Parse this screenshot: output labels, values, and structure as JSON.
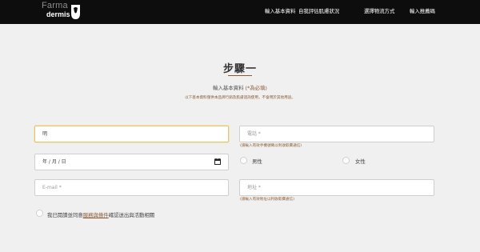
{
  "brand": {
    "line1": "Farma",
    "line2": "dermis"
  },
  "nav": [
    "輸入基本資料",
    "自我評估肌膚狀況",
    "選擇物流方式",
    "輸入推薦碼"
  ],
  "step": {
    "title": "步驟一",
    "subtitle": "輸入基本資料",
    "required": "(*為必填)",
    "note": "以下基本資料僅供本品牌行銷及肌膚諮詢使用，不會用於其他用途。"
  },
  "form": {
    "name": "明",
    "phone_placeholder": "電話 *",
    "phone_helper": "(請輸入有效手機號碼以利收取費通信)",
    "birthdate_value": "年 / 月 / 日",
    "gender_options": [
      "男性",
      "女性"
    ],
    "email_placeholder": "E-mail *",
    "address_placeholder": "地址 *",
    "address_helper": "(請輸入有效地址以利收取費通信)"
  },
  "consent": {
    "prefix": "我已閱讀並同意",
    "link": "服務與條件",
    "suffix": "確認送出與活動相關"
  },
  "colors": {
    "accent": "#8b5a32",
    "nav_bg": "#0d0d0d",
    "focus": "#e3c777"
  }
}
